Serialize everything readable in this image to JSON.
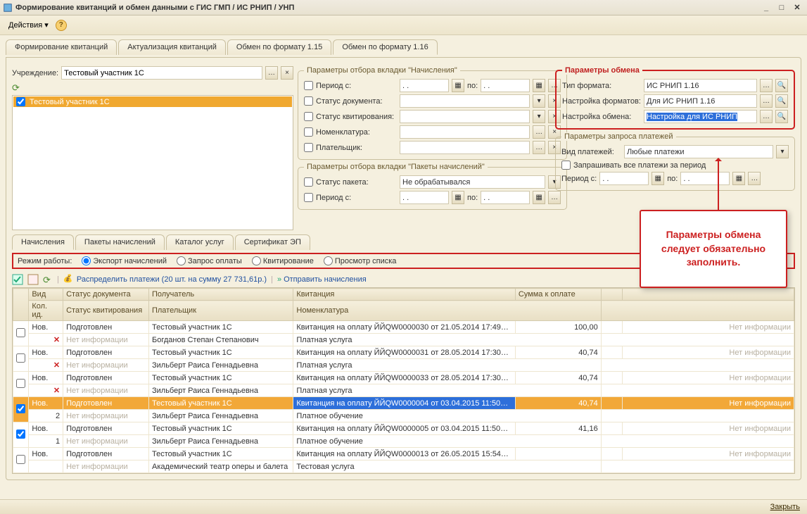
{
  "window": {
    "title": "Формирование квитанций и обмен данными с ГИС ГМП / ИС РНИП / УНП"
  },
  "toolbar": {
    "actions": "Действия"
  },
  "mainTabs": [
    "Формирование квитанций",
    "Актуализация квитанций",
    "Обмен по формату 1.15",
    "Обмен по формату 1.16"
  ],
  "org": {
    "label": "Учреждение:",
    "value": "Тестовый участник 1С"
  },
  "listItem": "Тестовый участник 1С",
  "filters1": {
    "legend": "Параметры отбора вкладки \"Начисления\"",
    "periodFrom": "Период с:",
    "periodTo": "по:",
    "periodFromVal": " .  .    ",
    "periodToVal": " .  .    ",
    "docStatus": "Статус документа:",
    "kvStatus": "Статус квитирования:",
    "nomen": "Номенклатура:",
    "payer": "Плательщик:"
  },
  "filters2": {
    "legend": "Параметры отбора вкладки \"Пакеты начислений\"",
    "pkgStatus": "Статус пакета:",
    "pkgStatusVal": "Не обрабатывался",
    "periodFrom": "Период с:",
    "periodTo": "по:",
    "periodFromVal": " .  .    ",
    "periodToVal": " .  .    "
  },
  "exchange": {
    "legend": "Параметры обмена",
    "fmt": "Тип формата:",
    "fmtVal": "ИС РНИП 1.16",
    "fmtCfg": "Настройка форматов:",
    "fmtCfgVal": "Для ИС РНИП 1.16",
    "exCfg": "Настройка обмена:",
    "exCfgVal": "Настройка для ИС РНИП"
  },
  "payReq": {
    "legend": "Параметры запроса платежей",
    "type": "Вид платежей:",
    "typeVal": "Любые платежи",
    "askAll": "Запрашивать все платежи за период",
    "periodFrom": "Период с:",
    "periodTo": "по:",
    "periodFromVal": " .  .    ",
    "periodToVal": " .  .    "
  },
  "subTabs": [
    "Начисления",
    "Пакеты начислений",
    "Каталог услуг",
    "Сертификат ЭП"
  ],
  "mode": {
    "label": "Режим работы:",
    "opts": [
      "Экспорт начислений",
      "Запрос оплаты",
      "Квитирование",
      "Просмотр списка"
    ]
  },
  "tools": {
    "distribute": "Распределить платежи (20 шт. на сумму 27 731,61р.)",
    "send": "Отправить начисления"
  },
  "cols": {
    "vid": "Вид",
    "docStatus": "Статус документа",
    "recv": "Получатель",
    "kv": "Квитанция",
    "sum": "Сумма к оплате",
    "kolid": "Кол. ид.",
    "kvStatus": "Статус квитирования",
    "payer": "Плательщик",
    "nomen": "Номенклатура"
  },
  "rows": [
    {
      "chk": false,
      "vid": "Нов.",
      "docStatus": "Подготовлен",
      "recv": "Тестовый участник 1С",
      "kv": "Квитанция на оплату ЙЙQW0000030 от 21.05.2014 17:49…",
      "sum": "100,00",
      "kolid": "",
      "m": true,
      "kvStatus": "Нет информации",
      "payer": "Богданов Степан Степанович",
      "nomen": "Платная услуга",
      "info": "Нет информации"
    },
    {
      "chk": false,
      "vid": "Нов.",
      "docStatus": "Подготовлен",
      "recv": "Тестовый участник 1С",
      "kv": "Квитанция на оплату ЙЙQW0000031 от 28.05.2014 17:30…",
      "sum": "40,74",
      "kolid": "",
      "m": true,
      "kvStatus": "Нет информации",
      "payer": "Зильберт Раиса Геннадьевна",
      "nomen": "Платная услуга",
      "info": "Нет информации"
    },
    {
      "chk": false,
      "vid": "Нов.",
      "docStatus": "Подготовлен",
      "recv": "Тестовый участник 1С",
      "kv": "Квитанция на оплату ЙЙQW0000033 от 28.05.2014 17:30…",
      "sum": "40,74",
      "kolid": "",
      "m": true,
      "kvStatus": "Нет информации",
      "payer": "Зильберт Раиса Геннадьевна",
      "nomen": "Платная услуга",
      "info": "Нет информации"
    },
    {
      "chk": true,
      "vid": "Нов.",
      "docStatus": "Подготовлен",
      "recv": "Тестовый участник 1С",
      "kv": "Квитанция на оплату ЙЙQW0000004 от 03.04.2015 11:50…",
      "sum": "40,74",
      "kolid": "2",
      "m": false,
      "kvStatus": "Нет информации",
      "payer": "Зильберт Раиса Геннадьевна",
      "nomen": "Платное обучение",
      "info": "Нет информации",
      "selected": true
    },
    {
      "chk": true,
      "vid": "Нов.",
      "docStatus": "Подготовлен",
      "recv": "Тестовый участник 1С",
      "kv": "Квитанция на оплату ЙЙQW0000005 от 03.04.2015 11:50…",
      "sum": "41,16",
      "kolid": "1",
      "m": false,
      "kvStatus": "Нет информации",
      "payer": "Зильберт Раиса Геннадьевна",
      "nomen": "Платное обучение",
      "info": "Нет информации"
    },
    {
      "chk": false,
      "vid": "Нов.",
      "docStatus": "Подготовлен",
      "recv": "Тестовый участник 1С",
      "kv": "Квитанция на оплату ЙЙQW0000013 от 26.05.2015 15:54…",
      "sum": "",
      "kolid": "",
      "m": false,
      "kvStatus": "Нет информации",
      "payer": "Академический театр оперы и балета",
      "nomen": "Тестовая услуга",
      "info": "Нет информации"
    }
  ],
  "note": "Параметры обмена следует обязательно заполнить.",
  "footer": {
    "close": "Закрыть"
  }
}
